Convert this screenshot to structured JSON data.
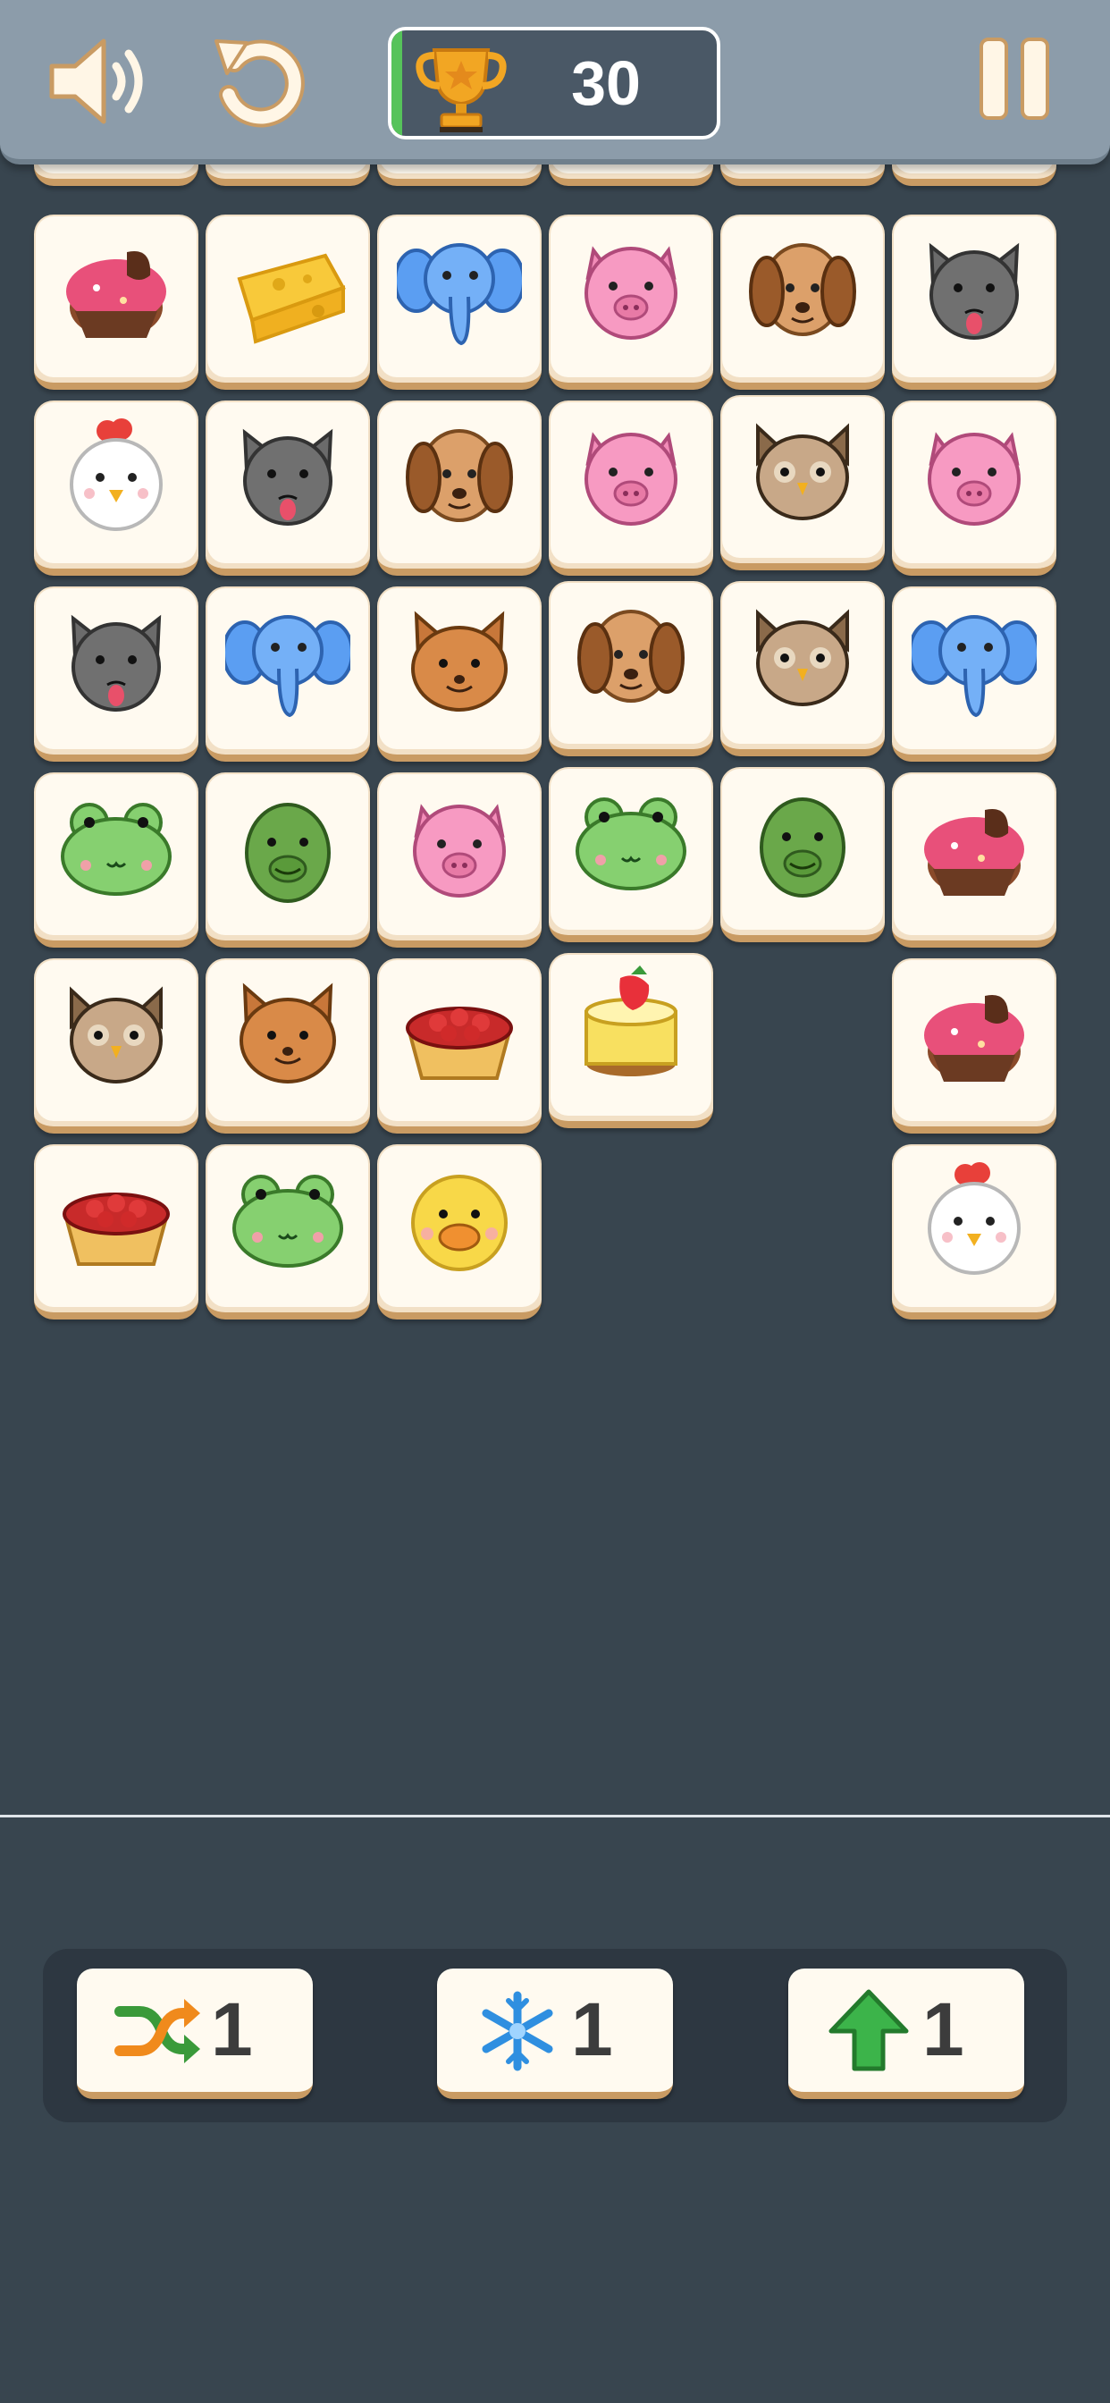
{
  "header": {
    "score": "30",
    "sound_icon": "speaker-icon",
    "undo_icon": "undo-icon",
    "pause_icon": "pause-icon",
    "trophy_icon": "trophy-icon"
  },
  "colors": {
    "background": "#38454f",
    "topbar": "#8c9caa",
    "tile_face": "#fffaf0",
    "tile_edge": "#c99b63",
    "score_accent": "#56c35a"
  },
  "board": {
    "rows": [
      [
        "partial",
        "partial",
        "partial",
        "partial",
        "partial",
        "partial"
      ],
      [
        "cake",
        "cheese",
        "elephant",
        "pig",
        "dog",
        "cat"
      ],
      [
        "chicken",
        "cat",
        "dog",
        "pig",
        "owl",
        "pig"
      ],
      [
        "cat",
        "elephant",
        "fox",
        "dog",
        "owl",
        "elephant"
      ],
      [
        "frog",
        "turtle",
        "pig",
        "frog",
        "turtle",
        "cake"
      ],
      [
        "owl",
        "fox",
        "tart",
        "cheesecake",
        null,
        "cake"
      ],
      [
        "tart",
        "frog",
        "chick",
        null,
        null,
        "chicken"
      ]
    ]
  },
  "powerups": [
    {
      "name": "shuffle",
      "icon": "shuffle-icon",
      "count": "1"
    },
    {
      "name": "freeze",
      "icon": "snowflake-icon",
      "count": "1"
    },
    {
      "name": "lift",
      "icon": "up-arrow-icon",
      "count": "1"
    }
  ]
}
